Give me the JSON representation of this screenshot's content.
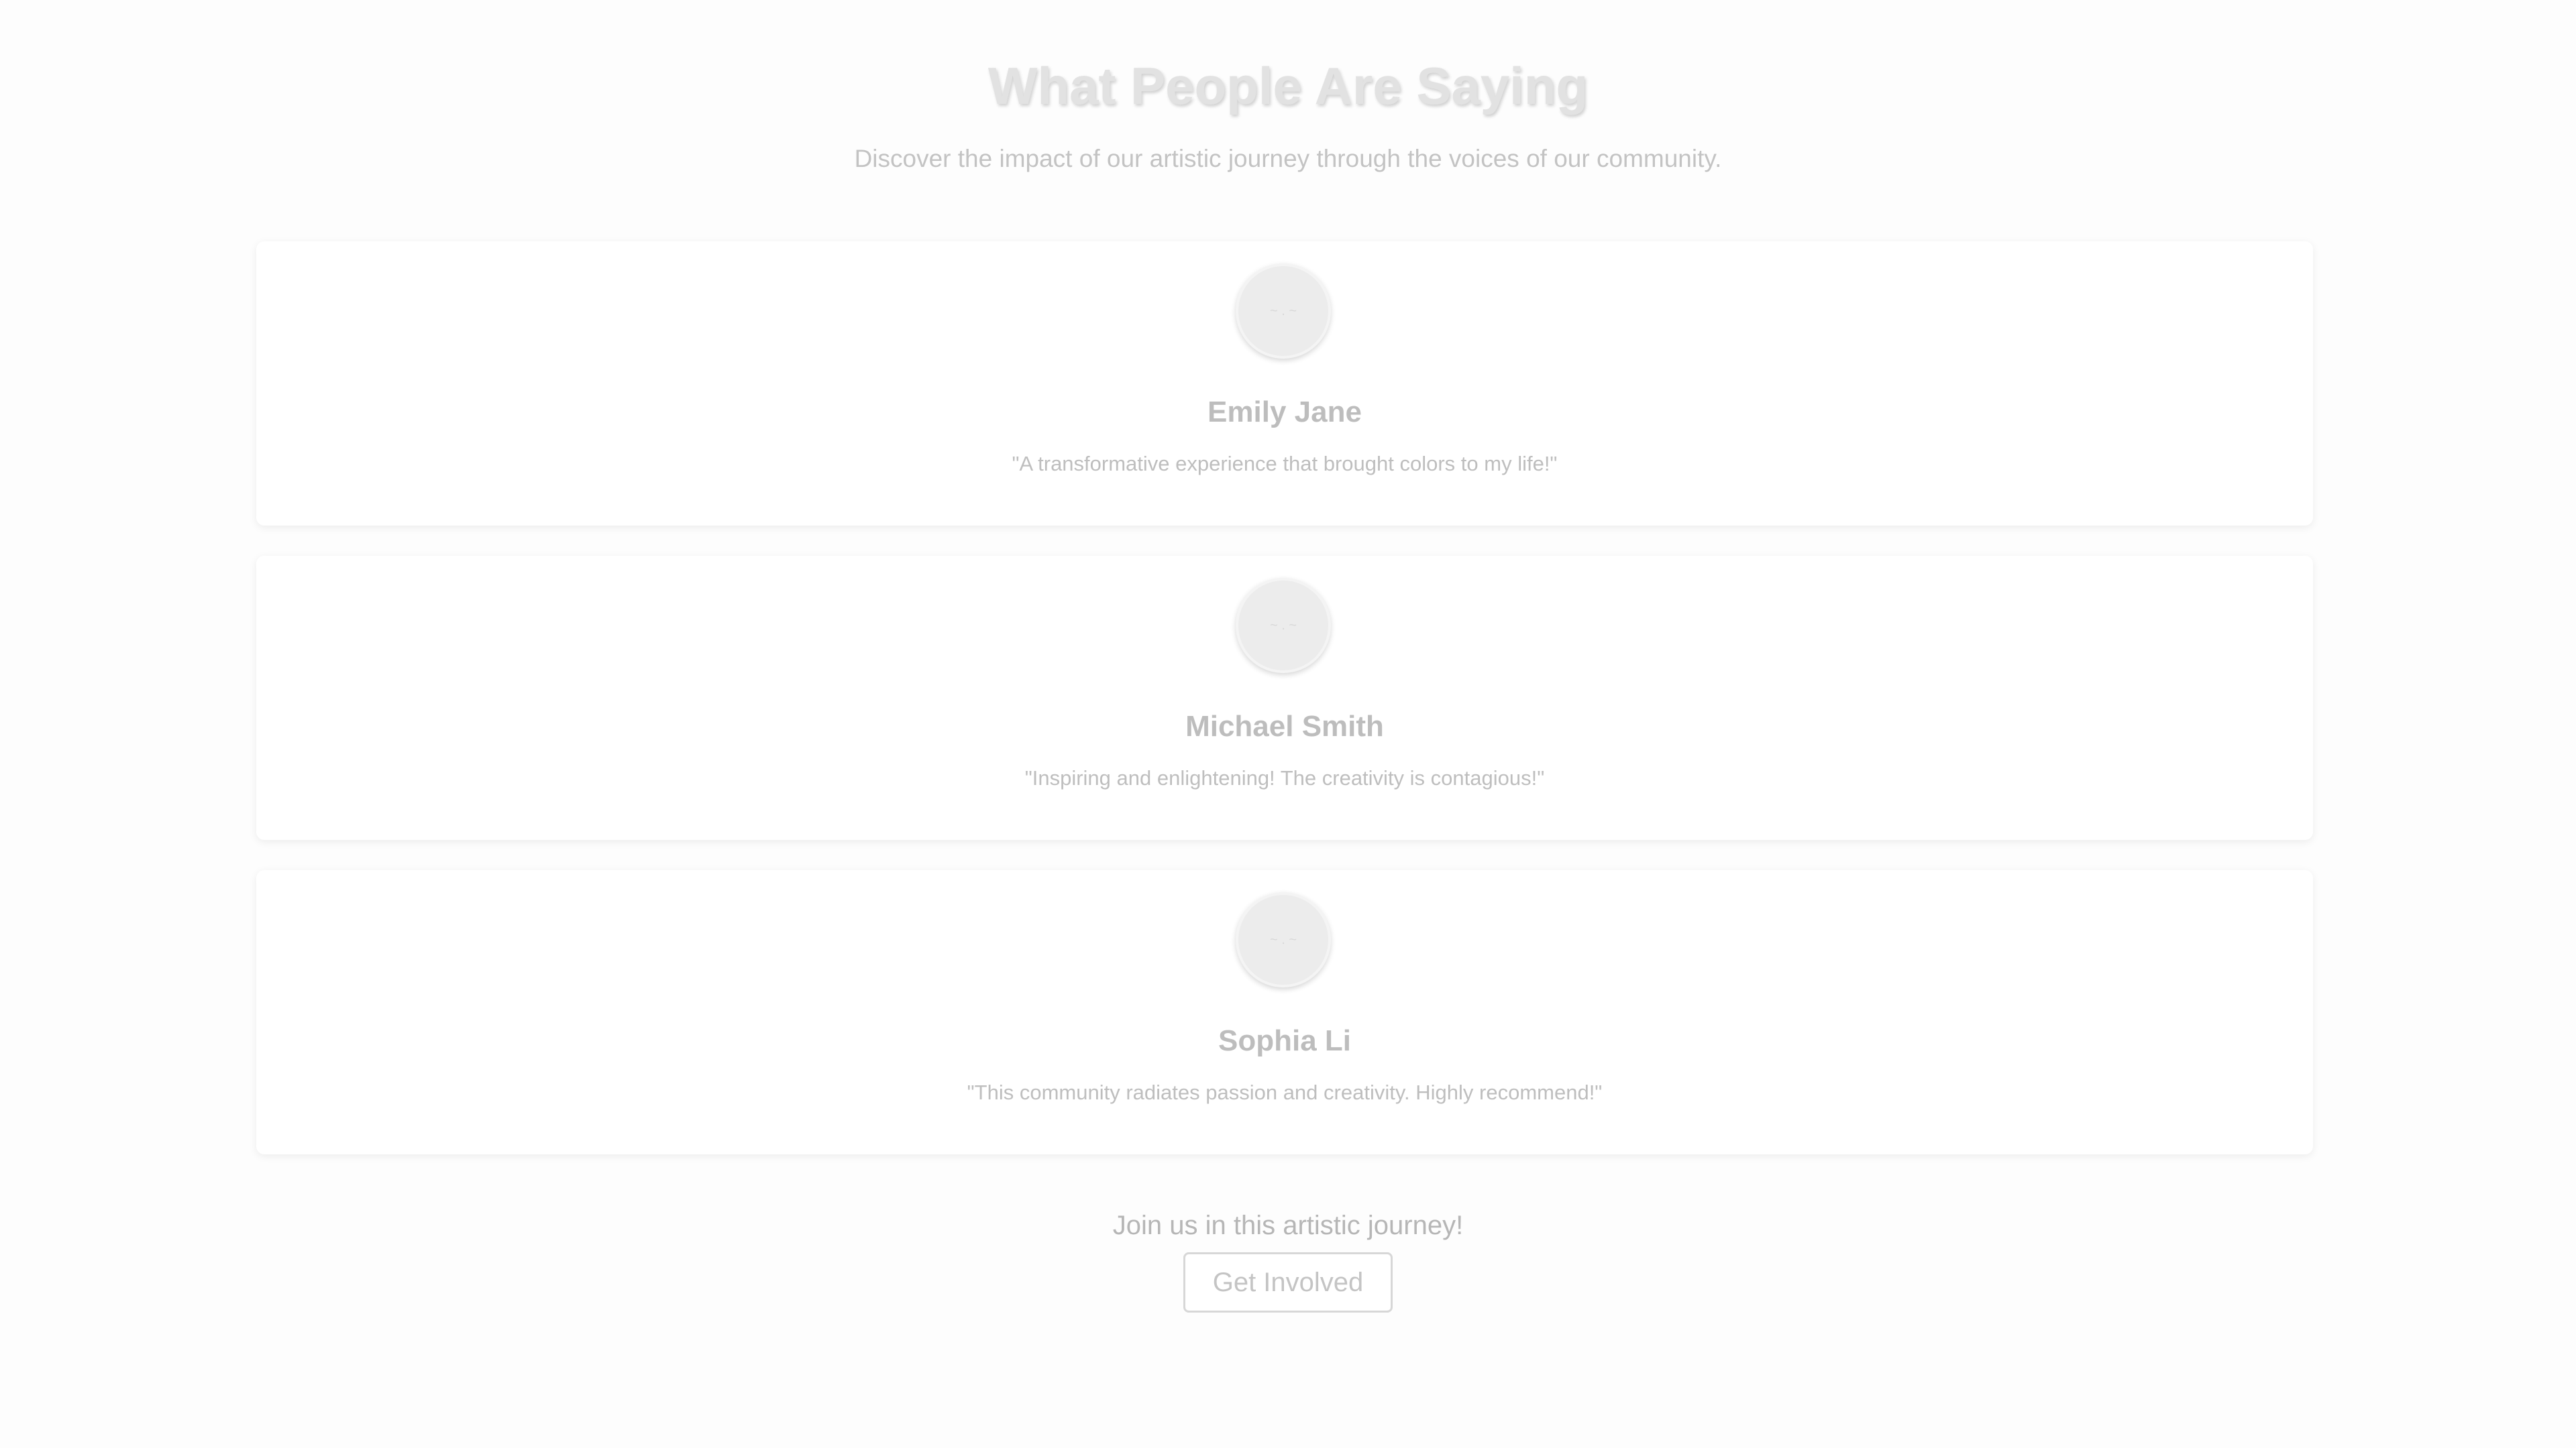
{
  "header": {
    "title": "What People Are Saying",
    "subtitle": "Discover the impact of our artistic journey through the voices of our community."
  },
  "testimonials": [
    {
      "avatar_icon": "avatar-placeholder-icon",
      "avatar_glyph": "~ . ~",
      "name": "Emily Jane",
      "quote": "\"A transformative experience that brought colors to my life!\""
    },
    {
      "avatar_icon": "avatar-placeholder-icon",
      "avatar_glyph": "~ . ~",
      "name": "Michael Smith",
      "quote": "\"Inspiring and enlightening! The creativity is contagious!\""
    },
    {
      "avatar_icon": "avatar-placeholder-icon",
      "avatar_glyph": "~ . ~",
      "name": "Sophia Li",
      "quote": "\"This community radiates passion and creativity. Highly recommend!\""
    }
  ],
  "cta": {
    "text": "Join us in this artistic journey!",
    "button_label": "Get Involved"
  },
  "colors": {
    "background": "#fdfdfd",
    "card": "#ffffff",
    "title": "#e2e2e2",
    "text_muted": "#bebebe",
    "button_border": "#d7d7d7"
  }
}
